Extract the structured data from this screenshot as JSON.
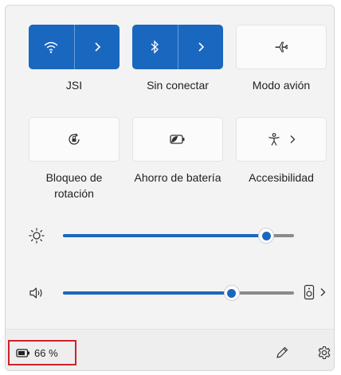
{
  "tiles": {
    "wifi": {
      "label": "JSI",
      "icon": "wifi-icon",
      "state": "on"
    },
    "bluetooth": {
      "label": "Sin conectar",
      "icon": "bluetooth-icon",
      "state": "on"
    },
    "airplane": {
      "label": "Modo avión",
      "icon": "airplane-icon",
      "state": "off"
    },
    "rotation": {
      "label_line1": "Bloqueo de",
      "label_line2": "rotación",
      "icon": "rotation-lock-icon",
      "state": "off"
    },
    "battery_saver": {
      "label": "Ahorro de batería",
      "icon": "battery-saver-icon",
      "state": "off"
    },
    "accessibility": {
      "label": "Accesibilidad",
      "icon": "accessibility-icon",
      "state": "off"
    }
  },
  "sliders": {
    "brightness": {
      "icon": "brightness-icon",
      "level": 0.88
    },
    "volume": {
      "icon": "speaker-icon",
      "level": 0.73,
      "output_icon": "speaker-device-icon"
    }
  },
  "footer": {
    "battery_text": "66 %",
    "battery_icon": "battery-icon",
    "edit_icon": "pencil-icon",
    "settings_icon": "gear-icon"
  },
  "colors": {
    "accent": "#1a67c0",
    "highlight_border": "#d1202a"
  }
}
